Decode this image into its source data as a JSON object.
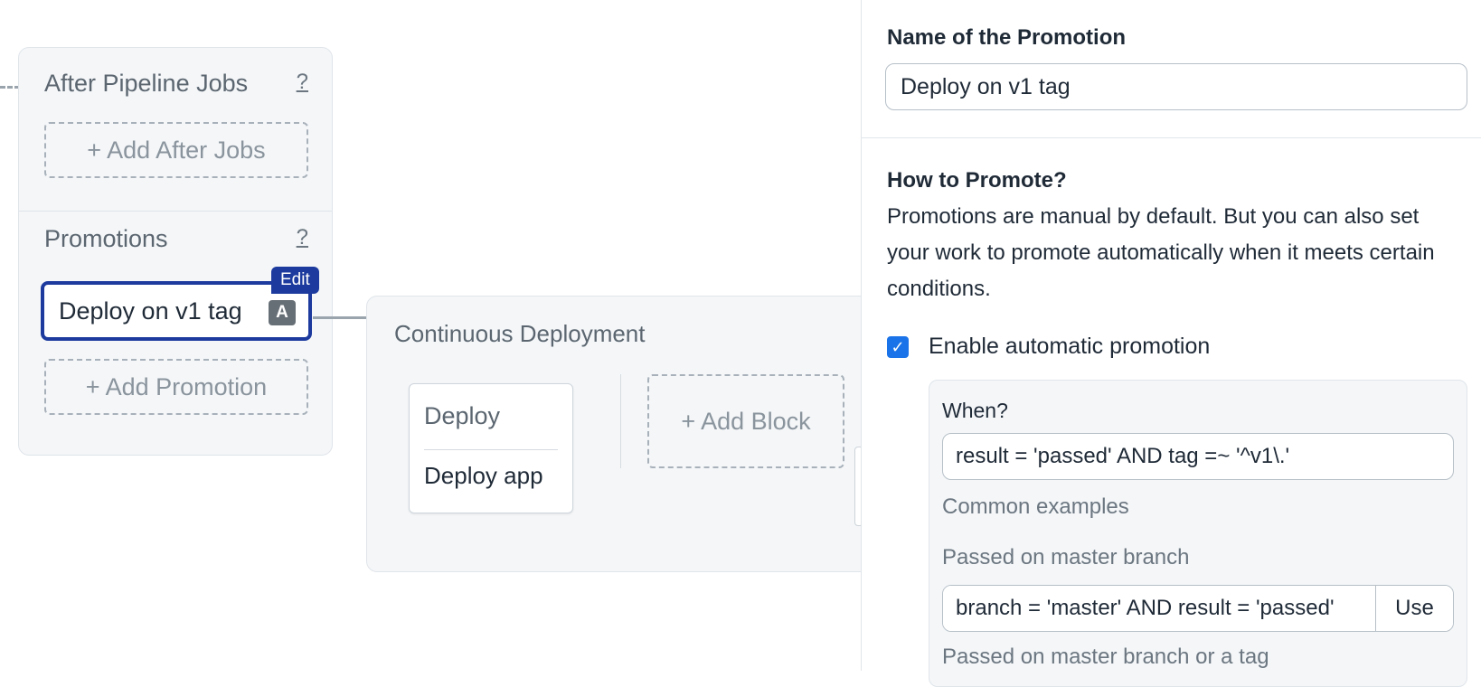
{
  "canvas": {
    "block": {
      "after_jobs": {
        "title": "After Pipeline Jobs",
        "help": "?",
        "add_label": "+ Add After Jobs"
      },
      "promotions": {
        "title": "Promotions",
        "help": "?",
        "item": {
          "label": "Deploy on v1 tag",
          "badge": "A",
          "edit_label": "Edit"
        },
        "add_label": "+ Add Promotion"
      }
    },
    "pipeline": {
      "title": "Continuous Deployment",
      "block": {
        "name": "Deploy",
        "job": "Deploy app"
      },
      "add_block_label": "+ Add Block"
    }
  },
  "panel": {
    "name_label": "Name of the Promotion",
    "name_value": "Deploy on v1 tag",
    "how_title": "How to Promote?",
    "how_desc": "Promotions are manual by default. But you can also set your work to promote automatically when it meets certain conditions.",
    "auto_label": "Enable automatic promotion",
    "auto_checked": true,
    "when_label": "When?",
    "when_value": "result = 'passed' AND tag =~ '^v1\\.'",
    "examples_title": "Common examples",
    "examples": [
      {
        "title": "Passed on master branch",
        "value": "branch = 'master' AND result = 'passed'",
        "use_label": "Use"
      },
      {
        "title": "Passed on master branch or a tag"
      }
    ]
  },
  "colors": {
    "accent": "#1d3b9e",
    "checkbox": "#1a73e8",
    "badge": "#676f76"
  }
}
